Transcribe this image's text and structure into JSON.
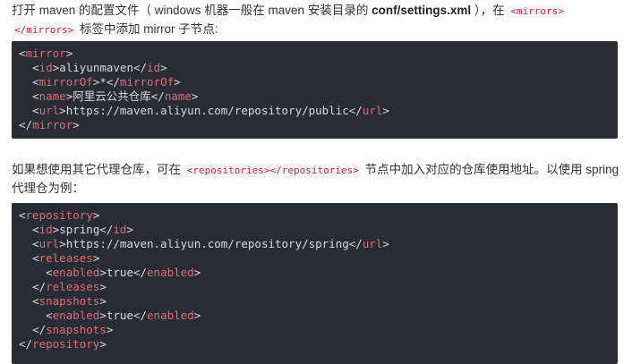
{
  "para1": {
    "part1": "打开 maven 的配置文件（ windows 机器一般在 maven 安装目录的 ",
    "bold": "conf/settings.xml",
    "part2": " ），在 ",
    "code1": "<mirrors>",
    "code2": "</mirrors>",
    "part3": " 标签中添加 mirror 子节点:"
  },
  "block1": {
    "lines": [
      {
        "indent": "",
        "open": "mirror",
        "text": "",
        "close": ""
      },
      {
        "indent": "  ",
        "open": "id",
        "text": "aliyunmaven",
        "close": "id"
      },
      {
        "indent": "  ",
        "open": "mirrorOf",
        "text": "*",
        "close": "mirrorOf"
      },
      {
        "indent": "  ",
        "open": "name",
        "text": "阿里云公共仓库",
        "close": "name"
      },
      {
        "indent": "  ",
        "open": "url",
        "text": "https://maven.aliyun.com/repository/public",
        "close": "url"
      },
      {
        "indent": "",
        "open": "",
        "text": "",
        "close": "mirror"
      }
    ]
  },
  "para2": {
    "part1": "如果想使用其它代理仓库，可在 ",
    "code1": "<repositories></repositories>",
    "part2": " 节点中加入对应的仓库使用地址。以使用 spring 代理仓为例："
  },
  "block2": {
    "lines": [
      {
        "indent": "",
        "open": "repository",
        "text": "",
        "close": ""
      },
      {
        "indent": "  ",
        "open": "id",
        "text": "spring",
        "close": "id"
      },
      {
        "indent": "  ",
        "open": "url",
        "text": "https://maven.aliyun.com/repository/spring",
        "close": "url"
      },
      {
        "indent": "  ",
        "open": "releases",
        "text": "",
        "close": ""
      },
      {
        "indent": "    ",
        "open": "enabled",
        "text": "true",
        "close": "enabled"
      },
      {
        "indent": "  ",
        "open": "",
        "text": "",
        "close": "releases"
      },
      {
        "indent": "  ",
        "open": "snapshots",
        "text": "",
        "close": ""
      },
      {
        "indent": "    ",
        "open": "enabled",
        "text": "true",
        "close": "enabled"
      },
      {
        "indent": "  ",
        "open": "",
        "text": "",
        "close": "snapshots"
      },
      {
        "indent": "",
        "open": "",
        "text": "",
        "close": "repository"
      }
    ]
  },
  "colors": {
    "code_bg": "#282c34",
    "tag": "#e06c75",
    "inline_code": "#c7254e"
  }
}
